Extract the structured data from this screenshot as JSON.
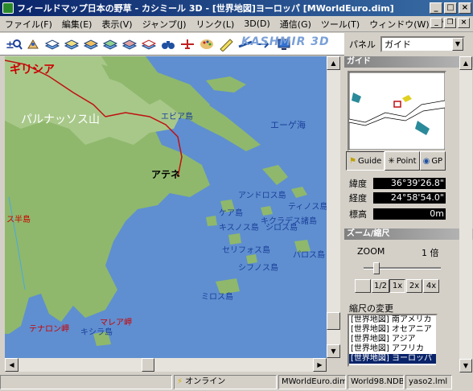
{
  "window": {
    "title": "フィールドマップ日本の野草 - カシミール 3D - [世界地図]ヨーロッパ [MWorldEuro.dim]",
    "controls": {
      "minimize": "_",
      "maximize": "□",
      "close": "×"
    }
  },
  "mdi_controls": {
    "minimize": "_",
    "restore": "❐",
    "close": "×"
  },
  "menu": [
    "ファイル(F)",
    "編集(E)",
    "表示(V)",
    "ジャンプ(J)",
    "リンク(L)",
    "3D(D)",
    "通信(G)",
    "ツール(T)",
    "ウィンドウ(W)",
    "?"
  ],
  "toolbar": {
    "tools": [
      "zoom-in-out-icon",
      "hiker-icon",
      "layer-icon",
      "layer-icon-2",
      "layer-icon-3",
      "layer-icon-4",
      "layer-icon-5",
      "layer-icon-6",
      "binoculars-icon",
      "plane-icon",
      "palette-icon",
      "pencil-icon",
      "route-icon",
      "arrow-icon",
      "monitor-icon"
    ],
    "brand": "KASHMIR 3D"
  },
  "panel": {
    "label": "パネル",
    "selected": "ガイド"
  },
  "map": {
    "labels": {
      "greece": "ギリシア",
      "parnassus": "パルナッソス山",
      "evia": "エビア島",
      "aegean": "エーゲ海",
      "athens": "アテネ",
      "andros": "アンドロス島",
      "tinos": "ティノス島",
      "kea": "ケア島",
      "kythnos": "キスノス島",
      "cyclades": "キクラデス諸島",
      "syros": "シロス島",
      "serifos": "セリフォス島",
      "paros": "パロス島",
      "sifnos": "シフノス島",
      "milos": "ミロス島",
      "tainaron": "テナロン岬",
      "malea": "マレア岬",
      "kythira": "キシラ島",
      "small_island": "ス半島"
    }
  },
  "guide": {
    "header": "ガイド",
    "tabs": [
      "Guide",
      "Point",
      "GP"
    ],
    "latitude_label": "緯度",
    "latitude": "36°39'26.8\"",
    "longitude_label": "経度",
    "longitude": "24°58'54.0\"",
    "elevation_label": "標高",
    "elevation": "0m"
  },
  "zoom": {
    "header": "ズーム/縮尺",
    "label": "ZOOM",
    "value": "1 倍",
    "level": 0.25,
    "buttons": [
      "1/2",
      "1x",
      "2x",
      "4x"
    ],
    "active": "1x",
    "scale_label": "縮尺の変更",
    "scales": [
      "[世界地図] 南アメリカ",
      "[世界地図] オセアニア",
      "[世界地図] アジア",
      "[世界地図] アフリカ",
      "[世界地図] ヨーロッパ"
    ],
    "selected_scale": "[世界地図] ヨーロッパ"
  },
  "status": {
    "online": "オンライン",
    "file1": "MWorldEuro.dim",
    "file2": "World98.NDB",
    "file3": "yaso2.lml"
  },
  "colors": {
    "titlebar": "#0a246a",
    "sea": "#5f8fd0",
    "land": "#8fb86c",
    "selection": "#0a246a",
    "label_red": "#cc0000",
    "label_blue": "#1a3f9a"
  }
}
